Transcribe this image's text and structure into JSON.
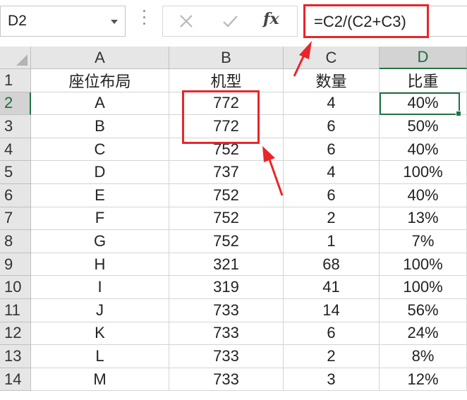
{
  "name_box": {
    "value": "D2"
  },
  "formula_bar": {
    "cancel_icon": "x-icon",
    "enter_icon": "check-icon",
    "fx_label": "fx",
    "formula": "=C2/(C2+C3)"
  },
  "columns": [
    "A",
    "B",
    "C",
    "D"
  ],
  "selected_column": "D",
  "header_row": {
    "row": "1",
    "cells": [
      "座位布局",
      "机型",
      "数量",
      "比重"
    ]
  },
  "rows": [
    {
      "row": "2",
      "cells": [
        "A",
        "772",
        "4",
        "40%"
      ]
    },
    {
      "row": "3",
      "cells": [
        "B",
        "772",
        "6",
        "50%"
      ]
    },
    {
      "row": "4",
      "cells": [
        "C",
        "752",
        "6",
        "40%"
      ]
    },
    {
      "row": "5",
      "cells": [
        "D",
        "737",
        "4",
        "100%"
      ]
    },
    {
      "row": "6",
      "cells": [
        "E",
        "752",
        "6",
        "40%"
      ]
    },
    {
      "row": "7",
      "cells": [
        "F",
        "752",
        "2",
        "13%"
      ]
    },
    {
      "row": "8",
      "cells": [
        "G",
        "752",
        "1",
        "7%"
      ]
    },
    {
      "row": "9",
      "cells": [
        "H",
        "321",
        "68",
        "100%"
      ]
    },
    {
      "row": "10",
      "cells": [
        "I",
        "319",
        "41",
        "100%"
      ]
    },
    {
      "row": "11",
      "cells": [
        "J",
        "733",
        "14",
        "56%"
      ]
    },
    {
      "row": "12",
      "cells": [
        "K",
        "733",
        "6",
        "24%"
      ]
    },
    {
      "row": "13",
      "cells": [
        "L",
        "733",
        "2",
        "8%"
      ]
    },
    {
      "row": "14",
      "cells": [
        "M",
        "733",
        "3",
        "12%"
      ]
    }
  ],
  "colors": {
    "accent": "#217346",
    "highlight": "#e8262a"
  }
}
